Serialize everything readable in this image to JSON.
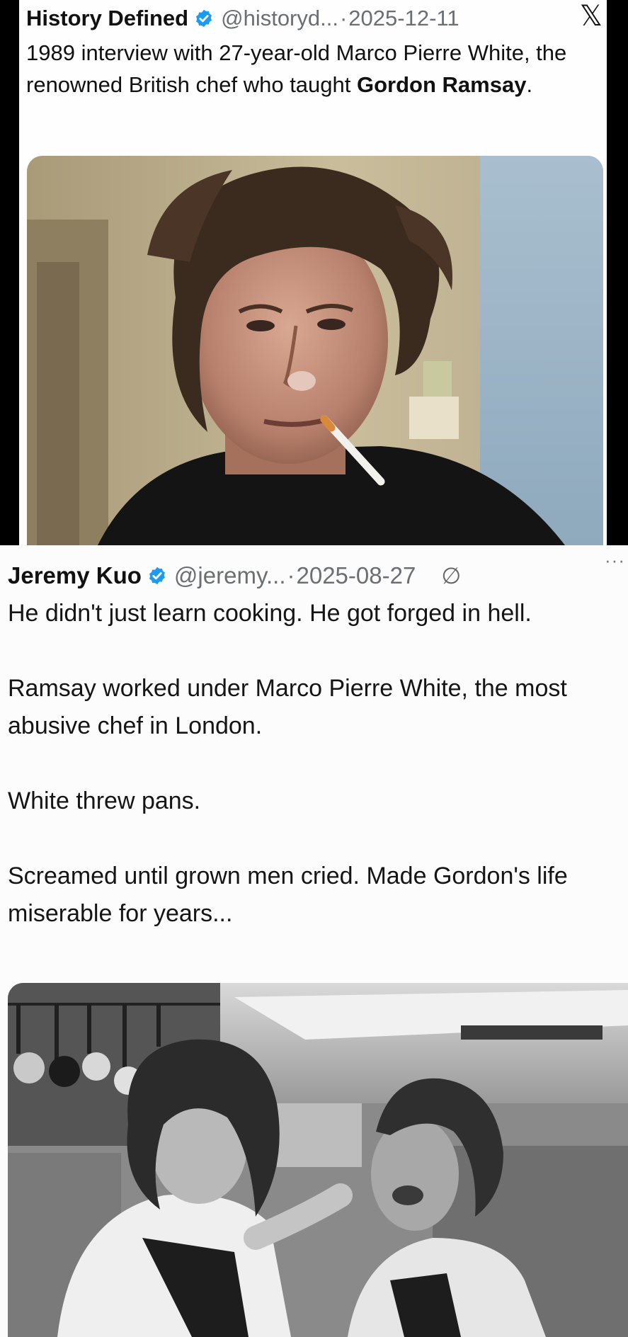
{
  "tweet1": {
    "display_name": "History Defined",
    "handle": "@historyd...",
    "separator": "·",
    "date": "2025-12-11",
    "platform_icon": "x-logo-icon",
    "platform_glyph": "𝕏",
    "text_part1": "1989 interview with 27-year-old Marco Pierre White, the renowned British chef who taught ",
    "text_bold": "Gordon Ramsay",
    "text_end": ".",
    "image_icon": "photo-portrait"
  },
  "tweet2": {
    "display_name": "Jeremy Kuo",
    "handle": "@jeremy...",
    "separator": "·",
    "date": "2025-08-27",
    "grok_glyph": "∅",
    "more_glyph": "···",
    "paragraphs": [
      "He didn't just learn cooking. He got forged in hell.",
      "Ramsay worked under Marco Pierre White, the most abusive chef in London.",
      "White threw pans.",
      "Screamed until grown men cried. Made Gordon's life miserable for years..."
    ],
    "image_icon": "photo-kitchen"
  },
  "colors": {
    "verified": "#1d9bf0",
    "muted": "#6b6e72",
    "text": "#111111"
  }
}
